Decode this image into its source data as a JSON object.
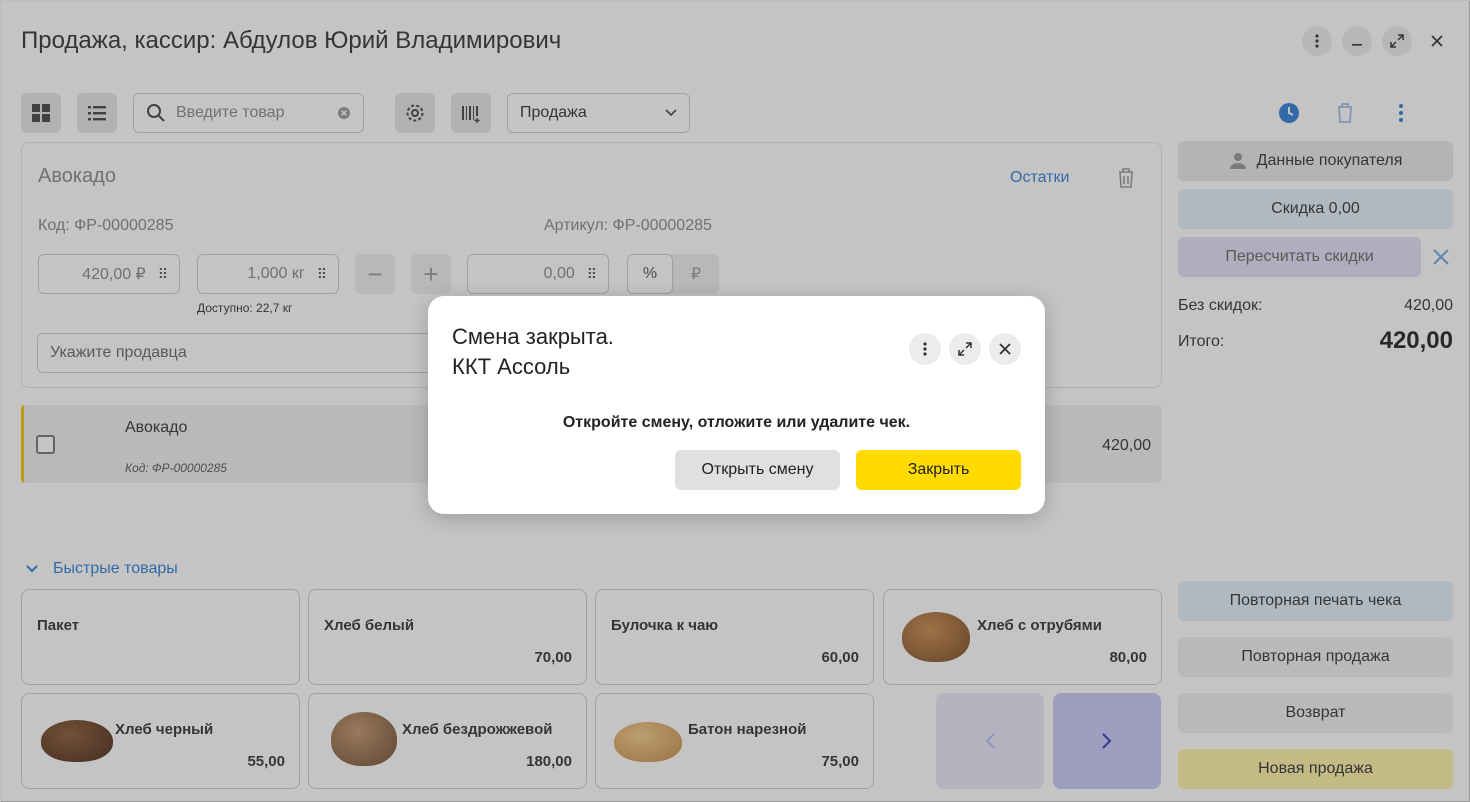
{
  "window": {
    "title": "Продажа, кассир: Абдулов Юрий Владимирович"
  },
  "toolbar": {
    "search_placeholder": "Введите товар",
    "mode_select": "Продажа"
  },
  "product": {
    "name": "Авокадо",
    "stock_link": "Остатки",
    "code_label": "Код:",
    "code_value": "ФР-00000285",
    "article_label": "Артикул:",
    "article_value": "ФР-00000285",
    "price": "420,00 ₽",
    "quantity": "1,000 кг",
    "available": "Доступно: 22,7 кг",
    "discount": "0,00",
    "percent_label": "%",
    "ruble_label": "₽",
    "seller_placeholder": "Укажите продавца"
  },
  "line_item": {
    "name": "Авокадо",
    "code": "Код: ФР-00000285",
    "sum": "420,00"
  },
  "side_panel": {
    "customer_button": "Данные покупателя",
    "discount_button": "Скидка 0,00",
    "recalc_button": "Пересчитать скидки",
    "no_discount_label": "Без скидок:",
    "no_discount_value": "420,00",
    "total_label": "Итого:",
    "total_value": "420,00",
    "reprint_button": "Повторная печать чека",
    "repeat_sale_button": "Повторная продажа",
    "return_button": "Возврат",
    "new_sale_button": "Новая продажа"
  },
  "quick_goods": {
    "title": "Быстрые товары",
    "items": [
      {
        "name": "Пакет",
        "price": ""
      },
      {
        "name": "Хлеб белый",
        "price": "70,00"
      },
      {
        "name": "Булочка к чаю",
        "price": "60,00"
      },
      {
        "name": "Хлеб с отрубями",
        "price": "80,00"
      },
      {
        "name": "Хлеб черный",
        "price": "55,00"
      },
      {
        "name": "Хлеб бездрожжевой",
        "price": "180,00"
      },
      {
        "name": "Батон нарезной",
        "price": "75,00"
      }
    ]
  },
  "dialog": {
    "title_line1": "Смена закрыта.",
    "title_line2": "ККТ Ассоль",
    "message": "Откройте смену, отложите или удалите чек.",
    "open_shift_button": "Открыть смену",
    "close_button": "Закрыть"
  },
  "colors": {
    "accent_yellow": "#ffdb00",
    "link_blue": "#2f7fd6",
    "overlay": "rgba(60,60,60,0.30)"
  }
}
